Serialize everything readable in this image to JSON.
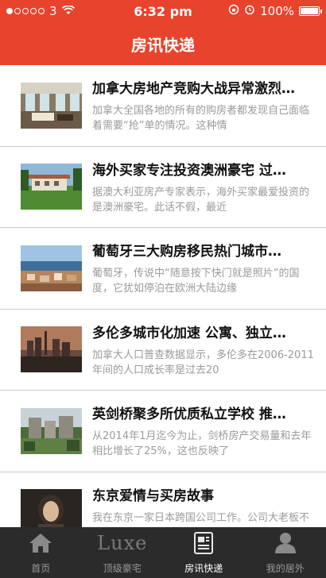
{
  "status_bar": {
    "carrier": "3",
    "time": "6:32 pm",
    "battery": "100%",
    "battery_level": 1.0
  },
  "nav": {
    "title": "房讯快递"
  },
  "articles": [
    {
      "title": "加拿大房地产竞购大战异常激烈…",
      "summary": "加拿大全国各地的所有的购房者都发现自己面临着需要“抢”单的情况。这种情",
      "thumb": "living-room-image"
    },
    {
      "title": "海外买家专注投资澳洲豪宅 过…",
      "summary": "据澳大利亚房产专家表示，海外买家最爱投资的是澳洲豪宅。此话不假，最近",
      "thumb": "mansion-image"
    },
    {
      "title": "葡萄牙三大购房移民热门城市…",
      "summary": "葡萄牙，传说中“随意按下快门就是照片”的国度，它犹如停泊在欧洲大陆边缘",
      "thumb": "coastal-city-image"
    },
    {
      "title": "多伦多城市化加速 公寓、独立…",
      "summary": "加拿大人口普查数据显示，多伦多在2006-2011年间的人口成长率是过去20",
      "thumb": "toronto-skyline-image"
    },
    {
      "title": "英剑桥聚多所优质私立学校 推…",
      "summary": "从2014年1月迄今为止，剑桥房产交易量和去年相比增长了25%，这也反映了",
      "thumb": "cambridge-image"
    },
    {
      "title": "东京爱情与买房故事",
      "summary": "我在东京一家日本跨国公司工作。公司大老板不仅和我家乡，还负责照顾我",
      "thumb": "portrait-image"
    }
  ],
  "tabs": [
    {
      "label": "首页",
      "icon": "home-icon",
      "active": false
    },
    {
      "label": "顶级豪宅",
      "icon": "luxe-logo",
      "logo_text": "Luxe",
      "active": false
    },
    {
      "label": "房讯快递",
      "icon": "news-icon",
      "active": true
    },
    {
      "label": "我的居外",
      "icon": "user-icon",
      "active": false
    }
  ]
}
